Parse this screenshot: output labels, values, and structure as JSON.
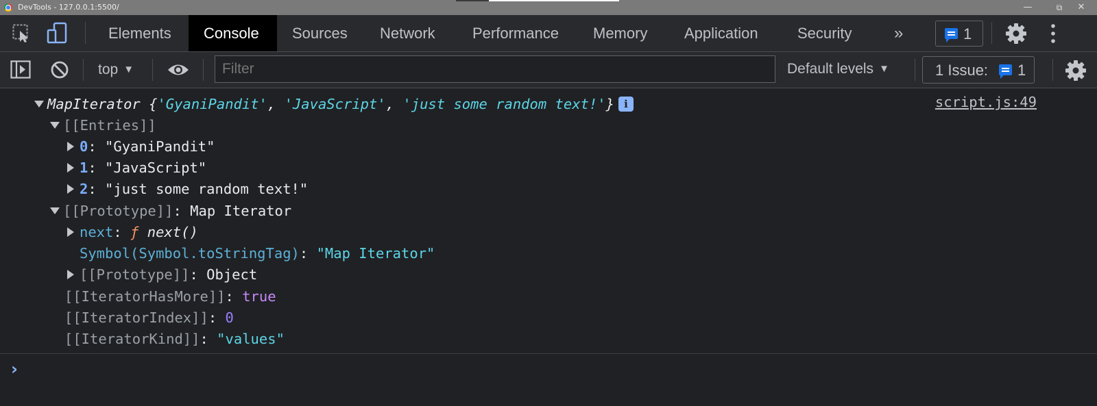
{
  "window": {
    "title": "DevTools - 127.0.0.1:5500/"
  },
  "tabs": [
    "Elements",
    "Console",
    "Sources",
    "Network",
    "Performance",
    "Memory",
    "Application",
    "Security"
  ],
  "tabbar": {
    "more_icon": "»",
    "issues_count": "1"
  },
  "toolbar": {
    "context": "top",
    "filter_placeholder": "Filter",
    "levels": "Default levels",
    "issues_label": "1 Issue:",
    "issues_count": "1"
  },
  "console": {
    "source": "script.js:49",
    "summary": {
      "type": "MapIterator",
      "open": " {",
      "items": [
        "'GyaniPandit'",
        "'JavaScript'",
        "'just some random text!'"
      ],
      "sep": ", ",
      "close": "}"
    },
    "entries_label": "[[Entries]]",
    "entries": [
      {
        "index": "0",
        "value": "\"GyaniPandit\""
      },
      {
        "index": "1",
        "value": "\"JavaScript\""
      },
      {
        "index": "2",
        "value": "\"just some random text!\""
      }
    ],
    "prototype": {
      "key": "[[Prototype]]",
      "value": "Map Iterator"
    },
    "next": {
      "key": "next",
      "f": "ƒ",
      "sig": "next()"
    },
    "symbol": {
      "key": "Symbol(Symbol.toStringTag)",
      "value": "\"Map Iterator\""
    },
    "proto2": {
      "key": "[[Prototype]]",
      "value": "Object"
    },
    "has_more": {
      "key": "[[IteratorHasMore]]",
      "value": "true"
    },
    "index": {
      "key": "[[IteratorIndex]]",
      "value": "0"
    },
    "kind": {
      "key": "[[IteratorKind]]",
      "value": "\"values\""
    },
    "colon": ": "
  },
  "colors": {
    "background": "#202124",
    "active_tab": "#000000",
    "string": "#5cd5e7",
    "keyword": "#c58af9",
    "number": "#9980ff",
    "accent": "#1a73e8"
  }
}
